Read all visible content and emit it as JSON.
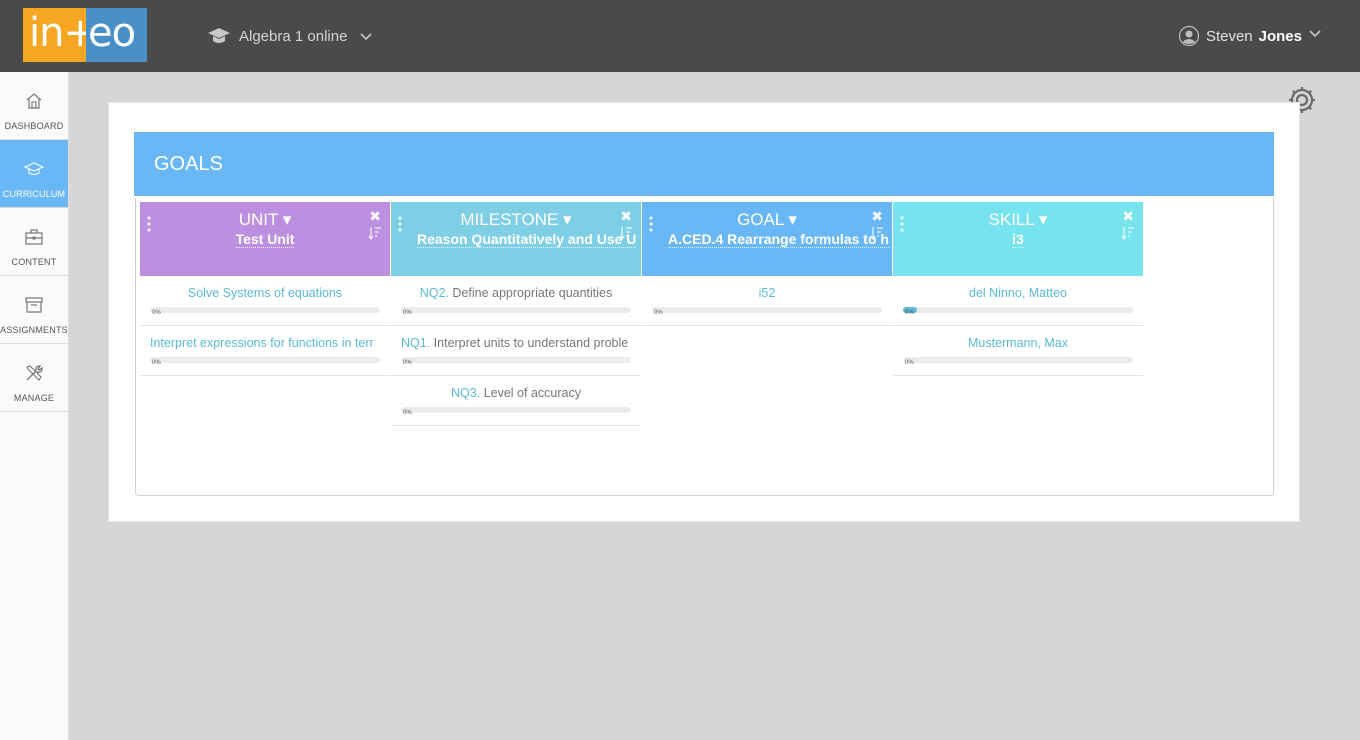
{
  "app": {
    "logo_left": "in+",
    "logo_right": "eo",
    "course": "Algebra 1 online",
    "user_first": "Steven",
    "user_last": "Jones"
  },
  "sidebar": {
    "items": [
      {
        "label": "DASHBOARD",
        "icon": "home-icon"
      },
      {
        "label": "CURRICULUM",
        "icon": "graduation-cap-icon",
        "active": true
      },
      {
        "label": "CONTENT",
        "icon": "briefcase-icon"
      },
      {
        "label": "ASSIGNMENTS",
        "icon": "archive-icon"
      },
      {
        "label": "MANAGE",
        "icon": "tools-icon"
      }
    ]
  },
  "goals": {
    "title": "GOALS",
    "columns": [
      {
        "title": "UNIT",
        "subtitle": "Test Unit",
        "color": "#bd8fe0",
        "rows": [
          {
            "code": "",
            "text": "Solve Systems of equations",
            "progress": "0%",
            "progress_value": 0
          },
          {
            "code": "",
            "text": "Interpret expressions for functions in terr",
            "progress": "0%",
            "progress_value": 0
          }
        ]
      },
      {
        "title": "MILESTONE",
        "subtitle": "Reason Quantitatively and Use U",
        "color": "#7ecfe6",
        "rows": [
          {
            "code": "NQ2.",
            "text": "Define appropriate quantities",
            "progress": "0%",
            "progress_value": 0
          },
          {
            "code": "NQ1.",
            "text": "Interpret units to understand proble",
            "progress": "0%",
            "progress_value": 0
          },
          {
            "code": "NQ3.",
            "text": "Level of accuracy",
            "progress": "0%",
            "progress_value": 0
          }
        ]
      },
      {
        "title": "GOAL",
        "subtitle": "A.CED.4 Rearrange formulas to h",
        "color": "#6ab7f5",
        "rows": [
          {
            "code": "",
            "text": "i52",
            "progress": "0%",
            "progress_value": 0
          }
        ]
      },
      {
        "title": "SKILL",
        "subtitle": "i3",
        "color": "#77e3ef",
        "rows": [
          {
            "code": "",
            "text": "del Ninno, Matteo",
            "progress": "0%",
            "progress_value": 6
          },
          {
            "code": "",
            "text": "Mustermann, Max",
            "progress": "0%",
            "progress_value": 0
          }
        ]
      }
    ]
  }
}
